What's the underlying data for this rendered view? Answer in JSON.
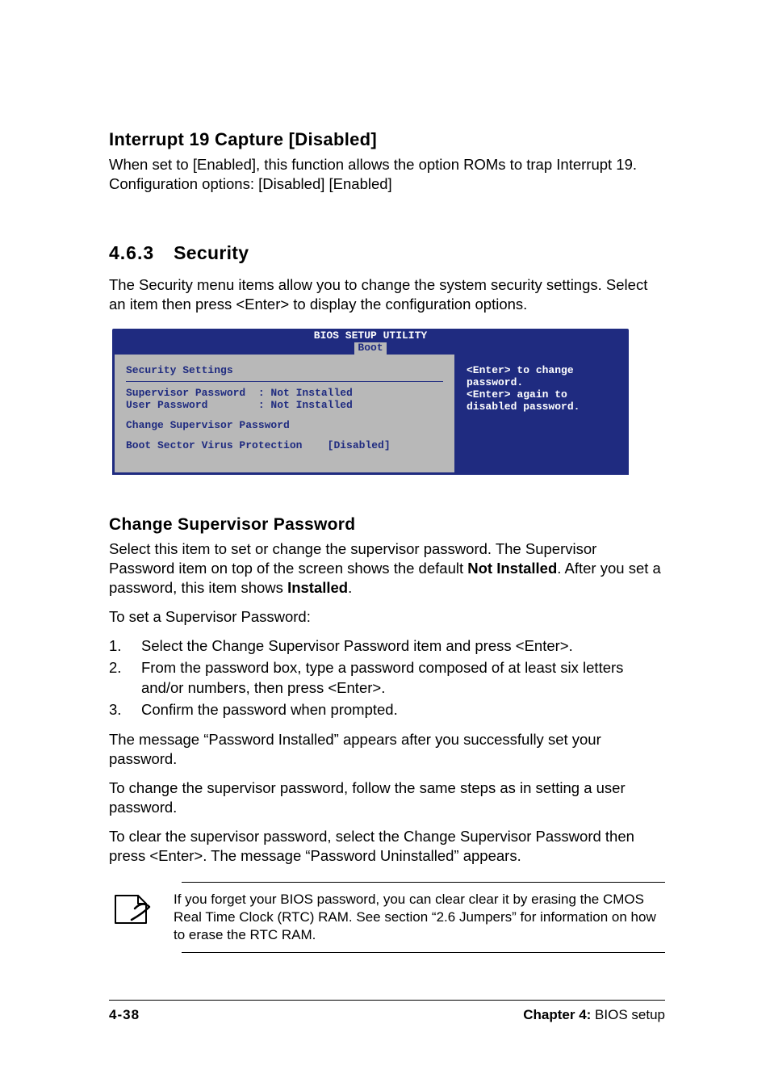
{
  "section1": {
    "heading": "Interrupt 19 Capture [Disabled]",
    "text": "When set to [Enabled], this function allows the option ROMs to trap Interrupt 19. Configuration options: [Disabled] [Enabled]"
  },
  "section2": {
    "num": "4.6.3",
    "title": "Security",
    "intro": "The Security menu items allow you to change the system security settings. Select an item then press <Enter> to display the configuration options."
  },
  "bios": {
    "title": "BIOS SETUP UTILITY",
    "tab": "Boot",
    "left": {
      "header": "Security Settings",
      "supervisor": "Supervisor Password  : Not Installed",
      "user": "User Password        : Not Installed",
      "change": "Change Supervisor Password",
      "bootsector": "Boot Sector Virus Protection    [Disabled]"
    },
    "right": {
      "l1": "<Enter> to change",
      "l2": "password.",
      "l3": "<Enter> again to",
      "l4": "disabled password."
    }
  },
  "section3": {
    "heading": "Change Supervisor Password",
    "p1_a": "Select this item to set or change the supervisor password. The Supervisor Password item on top of the screen shows the default ",
    "p1_bold1": "Not Installed",
    "p1_b": ". After you set a password, this item shows ",
    "p1_bold2": "Installed",
    "p1_c": ".",
    "to_set": "To set a Supervisor Password:",
    "steps": [
      "Select the Change Supervisor Password item and press <Enter>.",
      "From the password box, type a password composed of at least six letters and/or numbers, then press <Enter>.",
      "Confirm the password when prompted."
    ],
    "p2": "The message “Password Installed” appears after you successfully set your password.",
    "p3": "To change the supervisor password, follow the same steps as in setting a user password.",
    "p4": "To clear the supervisor password, select the Change Supervisor Password then press <Enter>. The message “Password Uninstalled” appears."
  },
  "note": "If you forget your BIOS password, you can clear clear it by erasing the CMOS Real Time Clock (RTC) RAM. See section “2.6  Jumpers” for information on how to erase the RTC RAM.",
  "footer": {
    "page": "4-38",
    "chapter_label": "Chapter 4:",
    "chapter_name": " BIOS setup"
  }
}
